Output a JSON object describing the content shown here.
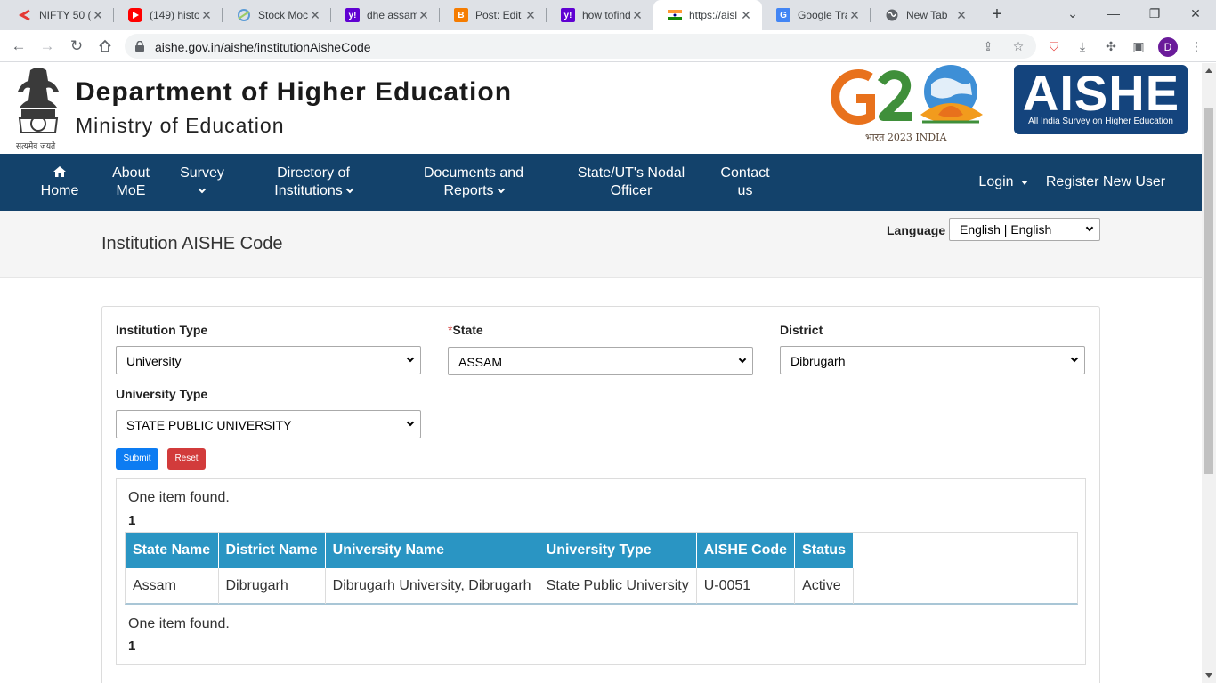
{
  "browser": {
    "tabs": [
      {
        "title": "NIFTY 50 (",
        "icon": "nifty-icon"
      },
      {
        "title": "(149) histo",
        "icon": "youtube-icon"
      },
      {
        "title": "Stock Moc",
        "icon": "stock-icon"
      },
      {
        "title": "dhe assam",
        "icon": "yahoo-icon"
      },
      {
        "title": "Post: Edit",
        "icon": "blogger-icon"
      },
      {
        "title": "how tofind",
        "icon": "yahoo-icon"
      },
      {
        "title": "https://aisl",
        "icon": "india-flag-icon"
      },
      {
        "title": "Google Tra",
        "icon": "translate-icon"
      },
      {
        "title": "New Tab",
        "icon": "globe-icon"
      }
    ],
    "active_tab_index": 6,
    "url": "aishe.gov.in/aishe/institutionAisheCode",
    "profile_initial": "D"
  },
  "header": {
    "title": "Department of Higher Education",
    "subtitle": "Ministry of Education",
    "emblem_motto": "सत्यमेव जयते",
    "g20_caption": "भारत 2023 INDIA",
    "aishe_logo_text": "AISHE",
    "aishe_logo_subtext": "All India Survey on Higher Education"
  },
  "nav": {
    "home": "Home",
    "about_line1": "About",
    "about_line2": "MoE",
    "survey": "Survey",
    "directory_line1": "Directory of",
    "directory_line2": "Institutions",
    "documents_line1": "Documents and",
    "documents_line2": "Reports",
    "nodal_line1": "State/UT's Nodal",
    "nodal_line2": "Officer",
    "contact_line1": "Contact",
    "contact_line2": "us",
    "login": "Login",
    "register": "Register New User"
  },
  "page": {
    "title": "Institution AISHE Code",
    "language_label": "Language",
    "language_value": "English | English"
  },
  "form": {
    "institution_type_label": "Institution Type",
    "institution_type_value": "University",
    "state_required_mark": "*",
    "state_label": "State",
    "state_value": "ASSAM",
    "district_label": "District",
    "district_value": "Dibrugarh",
    "university_type_label": "University Type",
    "university_type_value": "STATE PUBLIC UNIVERSITY",
    "submit_label": "Submit",
    "reset_label": "Reset"
  },
  "results": {
    "summary_top": "One item found.",
    "page_top": "1",
    "summary_bottom": "One item found.",
    "page_bottom": "1",
    "columns": [
      "State Name",
      "District Name",
      "University Name",
      "University Type",
      "AISHE Code",
      "Status"
    ],
    "rows": [
      [
        "Assam",
        "Dibrugarh",
        "Dibrugarh University, Dibrugarh",
        "State Public University",
        "U-0051",
        "Active"
      ]
    ]
  },
  "colors": {
    "navbar": "#13426b",
    "table_header": "#2a95c3",
    "submit": "#0d7cf2",
    "reset": "#d23b3b",
    "aishe_logo": "#14447d"
  }
}
